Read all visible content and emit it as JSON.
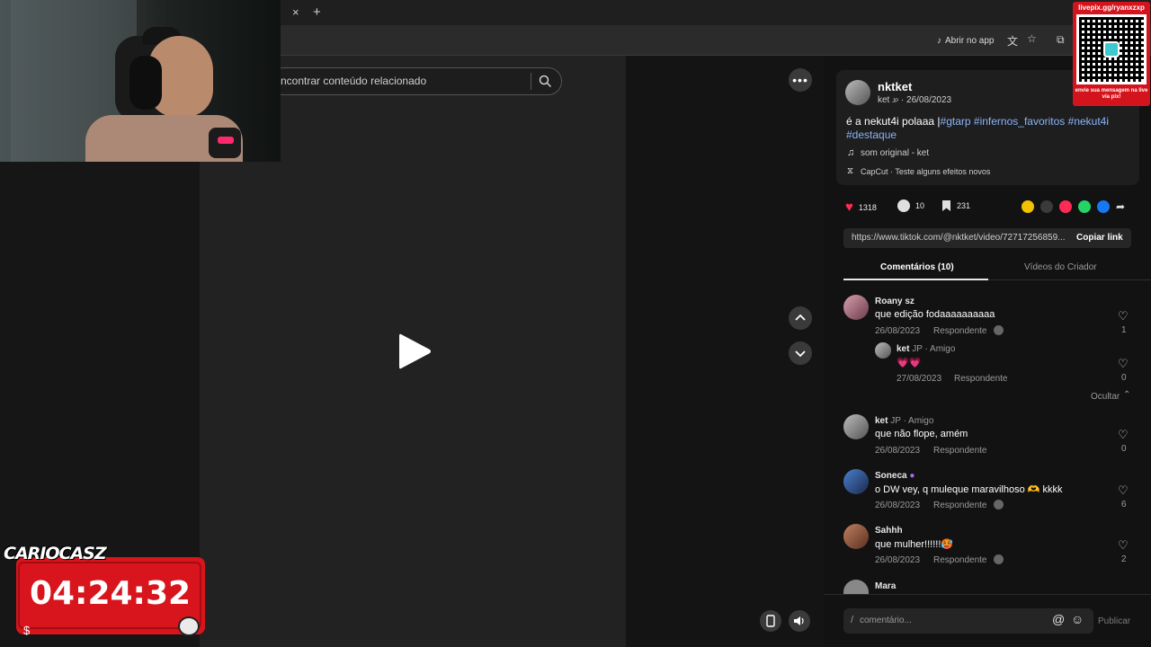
{
  "browser": {
    "tab_close": "×",
    "tab_new": "+",
    "open_app": "Abrir no app"
  },
  "search": {
    "placeholder": "ncontrar conteúdo relacionado"
  },
  "timer": {
    "brand": "CARIOCASZ",
    "time": "04:24:32"
  },
  "qr": {
    "url": "livepix.gg/ryanxzxp",
    "caption": "envie sua mensagem na live via pix!"
  },
  "post": {
    "username": "nktket",
    "nick": "ket",
    "nick_suffix": "JP",
    "date": "26/08/2023",
    "caption": "é a nekut4i polaaa |",
    "hashtags": [
      "#gtarp",
      "#infernos_favoritos",
      "#nekut4i",
      "#destaque"
    ],
    "sound": "som original - ket",
    "capcut": "CapCut · Teste alguns efeitos novos",
    "likes": "1318",
    "comments": "10",
    "saves": "231",
    "link": "https://www.tiktok.com/@nktket/video/72717256859...",
    "copy_link": "Copiar link"
  },
  "tabs": {
    "comments": "Comentários (10)",
    "creator": "Vídeos do Criador"
  },
  "comments": [
    {
      "name": "Roany sz",
      "text": "que edição fodaaaaaaaaaa",
      "date": "26/08/2023",
      "reply": "Respondente",
      "likes": "1"
    },
    {
      "name": "ket",
      "badge": "JP · Amigo",
      "text": "💗💗",
      "date": "27/08/2023",
      "reply": "Respondente",
      "likes": "0"
    },
    {
      "name": "ket",
      "badge": "JP · Amigo",
      "text": "que não flope, amém",
      "date": "26/08/2023",
      "reply": "Respondente",
      "likes": "0"
    },
    {
      "name": "Soneca",
      "text": "o DW vey, q muleque maravilhoso 🫶 kkkk",
      "date": "26/08/2023",
      "reply": "Respondente",
      "likes": "6"
    },
    {
      "name": "Sahhh",
      "text": "que mulher!!!!!!🥵",
      "date": "26/08/2023",
      "reply": "Respondente",
      "likes": "2"
    },
    {
      "name": "Mara"
    }
  ],
  "hide_label": "Ocultar",
  "composer": {
    "placeholder": "comentário...",
    "publish": "Publicar"
  },
  "colors": {
    "accent": "#fe2c55",
    "link": "#8ab4f8",
    "timer_red": "#d8141c"
  }
}
